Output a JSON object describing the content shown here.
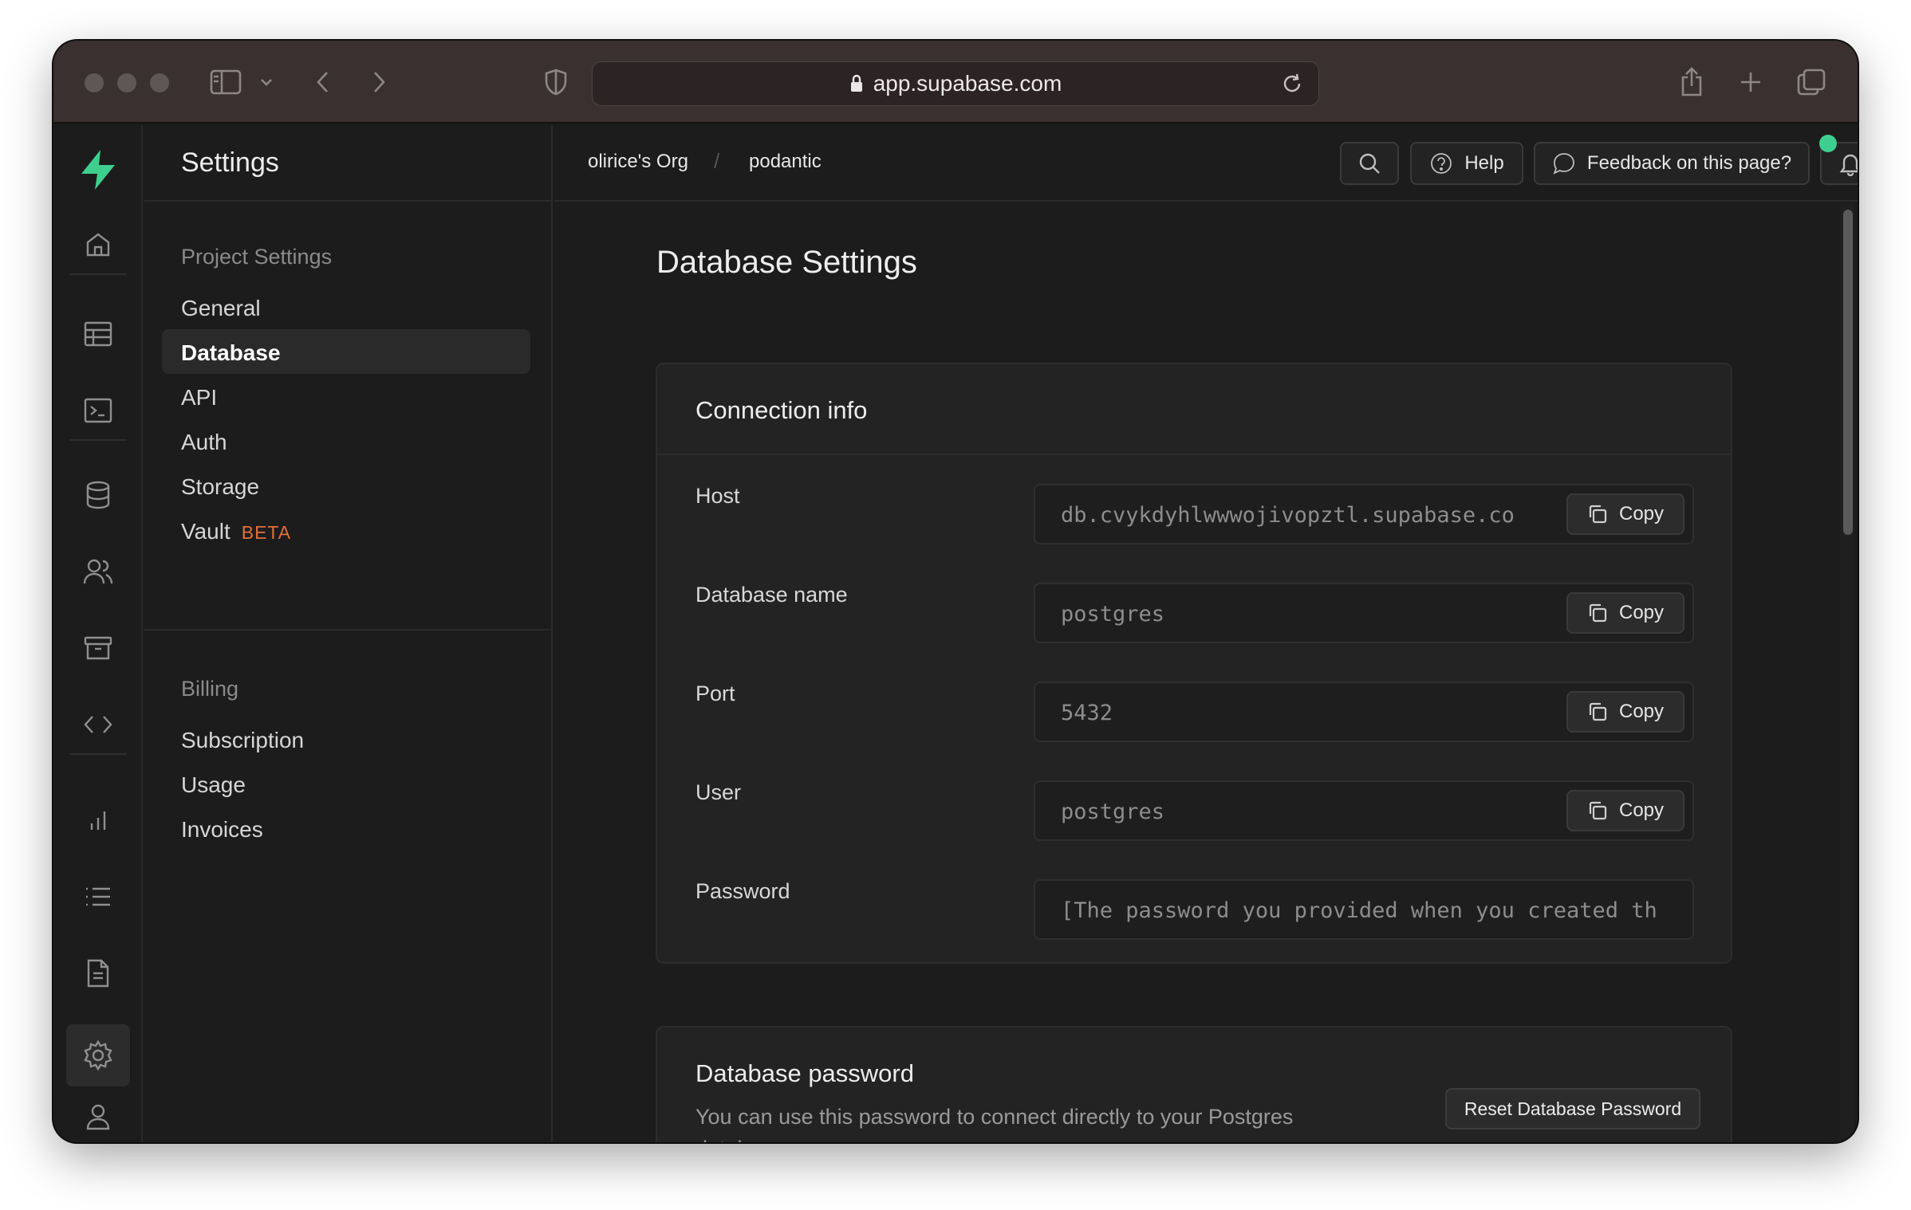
{
  "browser": {
    "url": "app.supabase.com"
  },
  "sidebar": {
    "title": "Settings",
    "sections": [
      {
        "title": "Project Settings",
        "items": [
          {
            "label": "General"
          },
          {
            "label": "Database",
            "active": true
          },
          {
            "label": "API"
          },
          {
            "label": "Auth"
          },
          {
            "label": "Storage"
          },
          {
            "label": "Vault",
            "badge": "BETA"
          }
        ]
      },
      {
        "title": "Billing",
        "items": [
          {
            "label": "Subscription"
          },
          {
            "label": "Usage"
          },
          {
            "label": "Invoices"
          }
        ]
      }
    ]
  },
  "topbar": {
    "breadcrumb": [
      "olirice's Org",
      "podantic"
    ],
    "help_label": "Help",
    "feedback_label": "Feedback on this page?"
  },
  "page": {
    "title": "Database Settings",
    "connection": {
      "title": "Connection info",
      "copy_label": "Copy",
      "fields": [
        {
          "label": "Host",
          "value": "db.cvykdyhlwwwojivopztl.supabase.co"
        },
        {
          "label": "Database name",
          "value": "postgres"
        },
        {
          "label": "Port",
          "value": "5432"
        },
        {
          "label": "User",
          "value": "postgres"
        },
        {
          "label": "Password",
          "value": "[The password you provided when you created th"
        }
      ]
    },
    "password": {
      "title": "Database password",
      "description": "You can use this password to connect directly to your Postgres database.",
      "reset_label": "Reset Database Password"
    }
  },
  "colors": {
    "brand": "#3ecf8e",
    "beta": "#e0703a",
    "background": "#1c1c1c"
  }
}
